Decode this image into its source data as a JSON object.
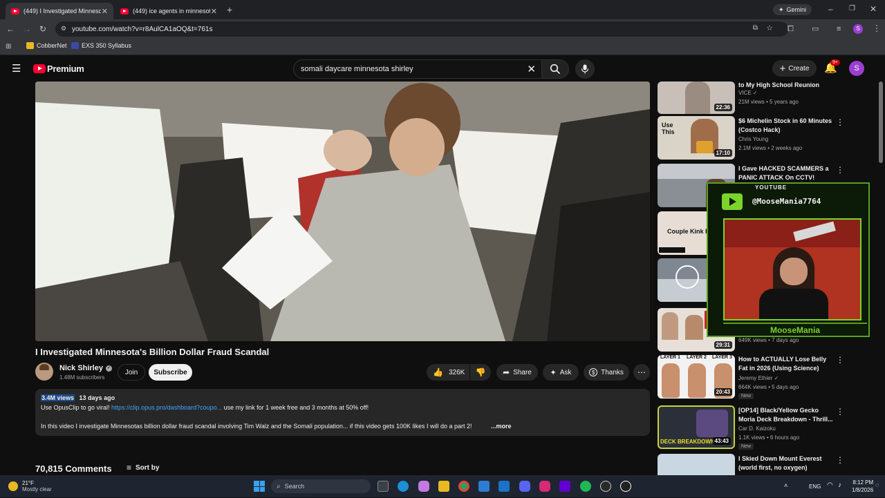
{
  "browser": {
    "tabs": [
      {
        "title": "(449) I Investigated Minnesota",
        "active": true
      },
      {
        "title": "(449) ice agents in minnesota -",
        "active": false
      }
    ],
    "gemini_label": "Gemini",
    "url": "youtube.com/watch?v=r8AulCA1aOQ&t=761s",
    "profile_initial": "S",
    "bookmarks": [
      "CobberNet",
      "EXS 350 Syllabus"
    ]
  },
  "youtube": {
    "logo_text": "Premium",
    "search_query": "somali daycare minnesota shirley",
    "create_label": "Create",
    "notif_count": "9+",
    "avatar_initial": "S"
  },
  "video": {
    "title": "I Investigated Minnesota's Billion Dollar Fraud Scandal",
    "channel": "Nick Shirley",
    "subscribers": "1.48M subscribers",
    "join_label": "Join",
    "subscribe_label": "Subscribe",
    "likes": "326K",
    "share_label": "Share",
    "ask_label": "Ask",
    "thanks_label": "Thanks",
    "views": "3.4M views",
    "age": "13 days ago",
    "desc_line1_prefix": "Use OpusClip to go viral! ",
    "desc_link": "https://clip.opus.pro/dashboard?coupo...",
    "desc_line1_suffix": " use my link for 1 week free and 3 months at 50% off!",
    "desc_line2": "In this video I investigate Minnesotas billion dollar fraud scandal involving Tim Walz and the Somali population... if this video gets 100K likes I will do a part 2!",
    "more_label": "...more",
    "comments_count": "70,815 Comments",
    "sort_label": "Sort by"
  },
  "recommendations": [
    {
      "title": "to My High School Reunion",
      "channel": "VICE",
      "meta": "21M views • 5 years ago",
      "duration": "22:36",
      "thumb_color": "#c8c0b8"
    },
    {
      "title": "$6 Michelin Stock in 60 Minutes (Costco Hack)",
      "channel": "Chris Young",
      "meta": "2.1M views • 2 weeks ago",
      "duration": "17:10",
      "thumb_color": "#d9d3c8",
      "thumb_text": "Use This"
    },
    {
      "title": "I Gave HACKED SCAMMERS a PANIC ATTACK On CCTV!",
      "channel": "",
      "meta": "",
      "duration": "",
      "thumb_color": "#8a8f96"
    },
    {
      "title": "",
      "channel": "",
      "meta": "",
      "duration": "2",
      "thumb_color": "#e8ddd5",
      "thumb_text": "Couple Kink Reve"
    },
    {
      "title": "",
      "channel": "",
      "meta": "",
      "duration": "",
      "thumb_color": "#7f8890"
    },
    {
      "title": "",
      "channel": "",
      "meta": "649K views • 7 days ago",
      "duration": "29:31",
      "thumb_color": "#e6e0d8"
    },
    {
      "title": "How to ACTUALLY Lose Belly Fat in 2026 (Using Science)",
      "channel": "Jeremy Ethier",
      "meta": "664K views • 5 days ago",
      "duration": "20:43",
      "badge": "New",
      "thumb_color": "#f2f2f2",
      "layers": [
        "LAYER 1",
        "LAYER 2",
        "LAYER 3"
      ]
    },
    {
      "title": "[OP14] Black/Yellow Gecko Moria Deck Breakdown - Thrill...",
      "channel": "Car D. Kaizoku",
      "meta": "1.1K views • 6 hours ago",
      "duration": "43:43",
      "badge": "New",
      "thumb_color": "#2a2f3a",
      "thumb_text": "DECK BREAKDOWN"
    },
    {
      "title": "I Skied Down Mount Everest (world first, no oxygen)",
      "channel": "",
      "meta": "",
      "duration": "",
      "thumb_color": "#c9d7e3"
    }
  ],
  "overlay": {
    "platform": "YOUTUBE",
    "handle": "@MooseMania7764",
    "name": "MooseMania"
  },
  "taskbar": {
    "weather_temp": "21°F",
    "weather_desc": "Mostly clear",
    "search_placeholder": "Search",
    "lang": "ENG",
    "time": "8:12 PM",
    "date": "1/8/2026"
  },
  "colors": {
    "yt_red": "#ff0033",
    "overlay_green": "#7bd42a",
    "link_blue": "#3ea6ff"
  }
}
